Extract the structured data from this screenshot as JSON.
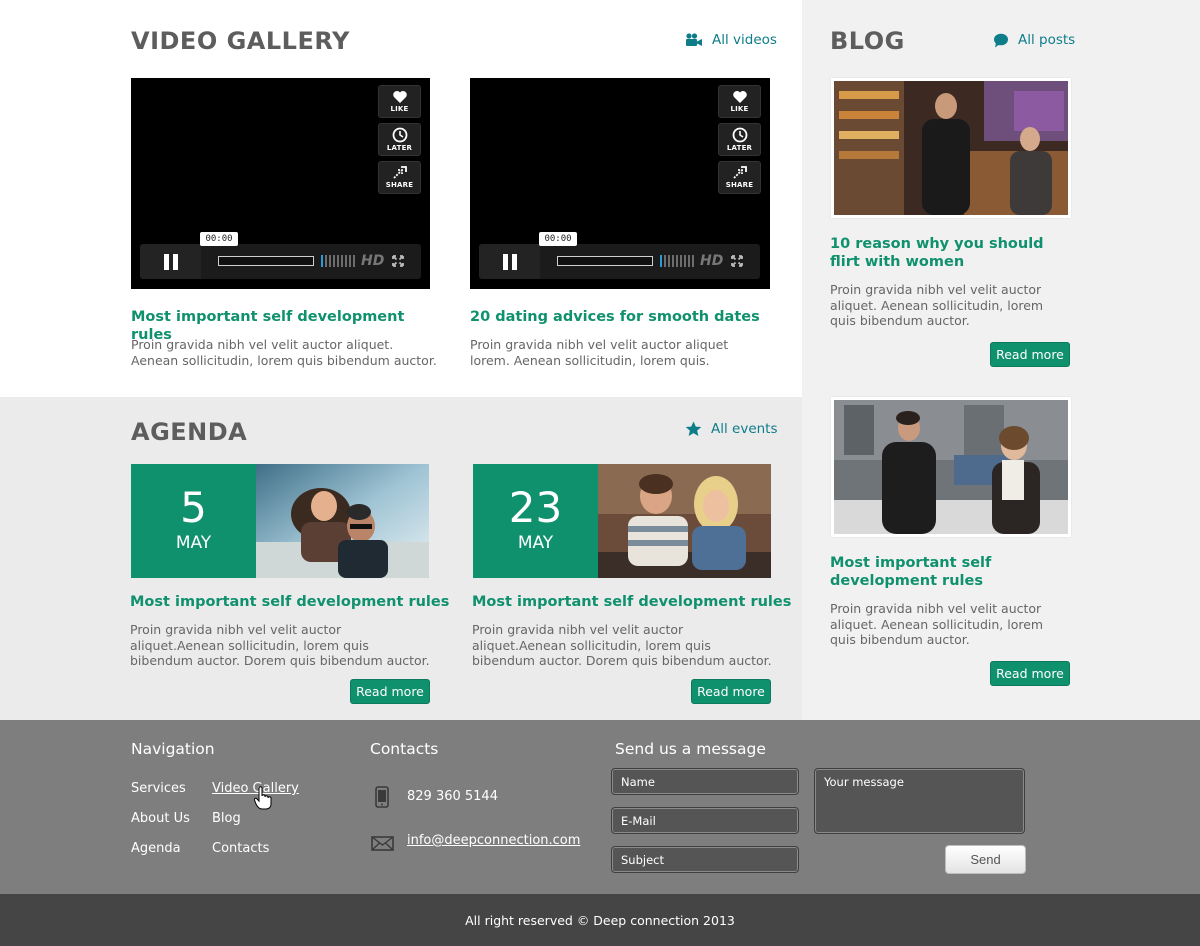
{
  "video": {
    "title": "VIDEO GALLERY",
    "all_link": "All videos",
    "player": {
      "time": "00:00",
      "like": "LIKE",
      "later": "LATER",
      "share": "SHARE",
      "hd": "HD"
    },
    "items": [
      {
        "title": "Most important self development rules",
        "text": "Proin gravida nibh vel velit auctor aliquet. Aenean sollicitudin, lorem quis bibendum auctor."
      },
      {
        "title": "20 dating advices for smooth dates",
        "text": "Proin gravida nibh vel velit auctor aliquet lorem. Aenean sollicitudin, lorem quis."
      }
    ]
  },
  "agenda": {
    "title": "AGENDA",
    "all_link": "All events",
    "items": [
      {
        "day": "5",
        "month": "MAY",
        "title": "Most important self development rules",
        "text": "Proin gravida nibh vel velit auctor aliquet.Aenean sollicitudin, lorem quis bibendum auctor. Dorem quis bibendum auctor.",
        "button": "Read more"
      },
      {
        "day": "23",
        "month": "MAY",
        "title": "Most important self development rules",
        "text": "Proin gravida nibh vel velit auctor aliquet.Aenean sollicitudin, lorem quis bibendum auctor. Dorem quis bibendum auctor.",
        "button": "Read more"
      }
    ]
  },
  "blog": {
    "title": "BLOG",
    "all_link": "All posts",
    "items": [
      {
        "title": "10 reason why you should flirt with women",
        "text": "Proin gravida nibh vel velit auctor aliquet. Aenean sollicitudin, lorem quis bibendum auctor.",
        "button": "Read more"
      },
      {
        "title": "Most important self development rules",
        "text": "Proin gravida nibh vel velit auctor aliquet. Aenean sollicitudin, lorem quis bibendum auctor.",
        "button": "Read more"
      }
    ]
  },
  "footer": {
    "navigation": {
      "heading": "Navigation",
      "links": [
        "Services",
        "Video Gallery",
        "About Us",
        "Blog",
        "Agenda",
        "Contacts"
      ]
    },
    "contacts": {
      "heading": "Contacts",
      "phone": "829 360 5144",
      "email": "info@deepconnection.com"
    },
    "message": {
      "heading": "Send us a message",
      "name_placeholder": "Name",
      "email_placeholder": "E-Mail",
      "subject_placeholder": "Subject",
      "message_placeholder": "Your message",
      "send": "Send"
    },
    "copyright": "All right reserved © Deep connection 2013"
  },
  "colors": {
    "accent": "#10916e",
    "link": "#0e7d8a",
    "footer_bg": "#7e7e7e",
    "copyright_bg": "#454545"
  }
}
